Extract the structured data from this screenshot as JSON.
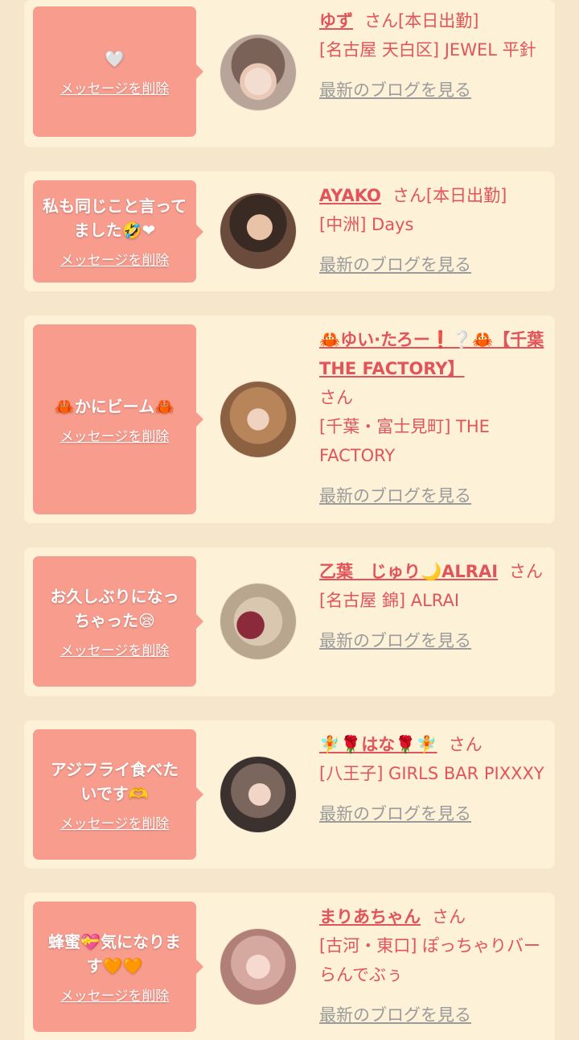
{
  "delete_label": "メッセージを削除",
  "blog_label": "最新のブログを見る",
  "colors": {
    "bubble": "#f89c8e",
    "accent": "#e1545a",
    "card": "#fdf1d8",
    "page": "#f5e6cc"
  },
  "items": [
    {
      "message": "🤍",
      "name": "ゆず",
      "suffix": "さん[本日出勤]",
      "location": "[名古屋 天白区] JEWEL 平針"
    },
    {
      "message": "私も同じこと言ってました🤣❤",
      "name": "AYAKO",
      "suffix": "さん[本日出勤]",
      "location": "[中洲] Days"
    },
    {
      "message": "🦀かにビーム🦀",
      "name": "🦀ゆい·たろー❗❔🦀【千葉THE FACTORY】",
      "suffix": "さん",
      "location": "[千葉・富士見町] THE FACTORY"
    },
    {
      "message": "お久しぶりになっちゃった😪",
      "name": "乙葉　じゅり🌙ALRAI",
      "suffix": "さん",
      "location": "[名古屋 錦] ALRAI"
    },
    {
      "message": "アジフライ食べたいです🫶",
      "name": "🧚🌹はな🌹🧚",
      "suffix": "さん",
      "location": "[八王子] GIRLS BAR PIXXXY"
    },
    {
      "message": "蜂蜜💝気になります🧡🧡",
      "name": "まりあちゃん",
      "suffix": "さん",
      "location": "[古河・東口] ぽっちゃりバー らんでぶぅ"
    }
  ]
}
